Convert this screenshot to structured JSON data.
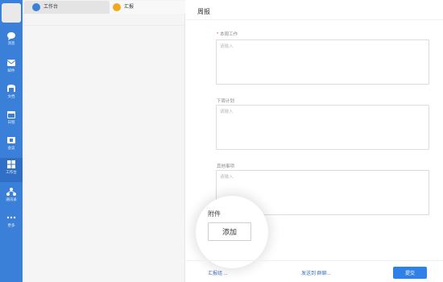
{
  "sidebar": {
    "items": [
      {
        "label": "消息",
        "icon": "chat-bubble-icon"
      },
      {
        "label": "邮件",
        "icon": "mail-icon"
      },
      {
        "label": "文档",
        "icon": "document-icon"
      },
      {
        "label": "日程",
        "icon": "calendar-icon"
      },
      {
        "label": "会议",
        "icon": "meeting-icon"
      },
      {
        "label": "工作台",
        "icon": "grid-icon"
      },
      {
        "label": "通讯录",
        "icon": "contacts-icon"
      },
      {
        "label": "更多",
        "icon": "more-icon"
      }
    ],
    "active_index": 5,
    "accent": "#3b80d8"
  },
  "tabs": [
    {
      "label": "工作台",
      "icon": "workbench-icon"
    },
    {
      "label": "汇报",
      "icon": "report-icon"
    }
  ],
  "form": {
    "title": "周报",
    "fields": [
      {
        "label": "本周工作",
        "required": true,
        "placeholder": "请输入",
        "value": ""
      },
      {
        "label": "下周计划",
        "required": false,
        "placeholder": "请输入",
        "value": ""
      },
      {
        "label": "其他事项",
        "required": false,
        "placeholder": "请输入",
        "value": ""
      }
    ],
    "attachment": {
      "label": "附件",
      "button": "添加"
    },
    "footer": {
      "group_link": "汇报组 ...",
      "send_to": "发送到 群聊...",
      "submit": "提交"
    }
  },
  "colors": {
    "primary": "#2f80e8",
    "required_mark": "#e64340"
  }
}
